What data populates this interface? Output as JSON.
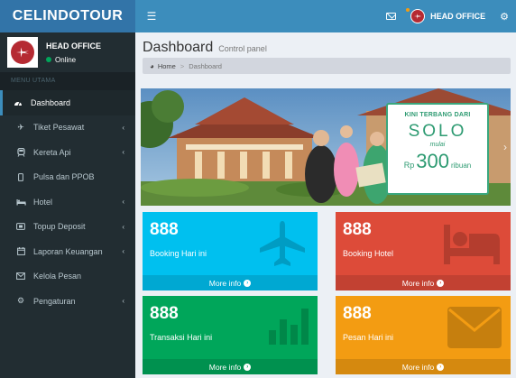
{
  "header": {
    "logo": "CELINDOTOUR",
    "user_name": "HEAD OFFICE"
  },
  "sidebar": {
    "user_title": "HEAD OFFICE",
    "user_status": "Online",
    "menu_header": "MENU UTAMA",
    "items": [
      {
        "label": "Dashboard",
        "icon": "dashboard-icon"
      },
      {
        "label": "Tiket Pesawat",
        "icon": "plane-icon"
      },
      {
        "label": "Kereta Api",
        "icon": "train-icon"
      },
      {
        "label": "Pulsa dan PPOB",
        "icon": "mobile-icon"
      },
      {
        "label": "Hotel",
        "icon": "bed-icon"
      },
      {
        "label": "Topup Deposit",
        "icon": "wallet-icon"
      },
      {
        "label": "Laporan Keuangan",
        "icon": "calendar-icon"
      },
      {
        "label": "Kelola Pesan",
        "icon": "envelope-icon"
      },
      {
        "label": "Pengaturan",
        "icon": "gears-icon"
      }
    ]
  },
  "page": {
    "title": "Dashboard",
    "subtitle": "Control panel",
    "breadcrumb": {
      "home": "Home",
      "current": "Dashboard"
    }
  },
  "banner": {
    "line1": "KINI TERBANG DARI",
    "city": "SOLO",
    "mulai": "mulai",
    "rp": "Rp",
    "price": "300",
    "ribuan": "ribuan"
  },
  "boxes": [
    {
      "value": "888",
      "label": "Booking Hari ini",
      "footer": "More info",
      "color": "#00c0ef",
      "icon": "plane-icon"
    },
    {
      "value": "888",
      "label": "Booking Hotel",
      "footer": "More info",
      "color": "#dd4b39",
      "icon": "bed-icon"
    },
    {
      "value": "888",
      "label": "Transaksi Hari ini",
      "footer": "More info",
      "color": "#00a65a",
      "icon": "bar-chart-icon"
    },
    {
      "value": "888",
      "label": "Pesan Hari ini",
      "footer": "More info",
      "color": "#f39c12",
      "icon": "envelope-icon"
    }
  ]
}
